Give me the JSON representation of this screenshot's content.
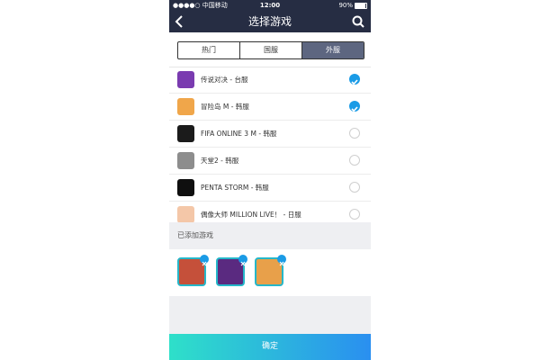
{
  "status": {
    "carrier": "●●●●○ 中国移动",
    "time": "12:00",
    "battery": "90%",
    "battery_level": 0.9
  },
  "nav": {
    "title": "选择游戏",
    "back_icon": "chevron-left-icon",
    "search_icon": "search-icon"
  },
  "tabs": [
    {
      "label": "热门",
      "active": false
    },
    {
      "label": "国服",
      "active": false
    },
    {
      "label": "外服",
      "active": true
    }
  ],
  "games": [
    {
      "name": "传说对决 - 台服",
      "checked": true,
      "color": "#7a3bb0"
    },
    {
      "name": "冒险岛 M - 韩服",
      "checked": true,
      "color": "#f0a64a"
    },
    {
      "name": "FIFA ONLINE 3 M - 韩服",
      "checked": false,
      "color": "#1b1b1b"
    },
    {
      "name": "天堂2 - 韩服",
      "checked": false,
      "color": "#8d8d8d"
    },
    {
      "name": "PENTA STORM - 韩服",
      "checked": false,
      "color": "#0f0f0f"
    },
    {
      "name": "偶像大师 MILLION LIVE！ - 日服",
      "checked": false,
      "color": "#f4c7a8"
    }
  ],
  "added": {
    "title": "已添加游戏",
    "items": [
      {
        "icon": "game-icon-1",
        "color": "#c5503a"
      },
      {
        "icon": "game-icon-2",
        "color": "#5a2a80"
      },
      {
        "icon": "game-icon-3",
        "color": "#e8a04a"
      }
    ]
  },
  "confirm_label": "确定",
  "colors": {
    "nav": "#262d43",
    "accent": "#1a9be6",
    "tab_active": "#5d6680"
  }
}
